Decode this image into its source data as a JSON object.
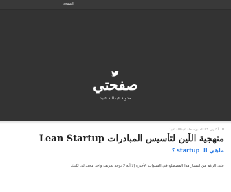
{
  "nav": {
    "link_label": "الصفحة"
  },
  "header": {
    "icon": "twitter-icon",
    "site_title": "صفحتي",
    "tagline": "مدونة عبدالله عبيد"
  },
  "post": {
    "meta": "10 أكتوبر، 2013 بواسطة عبدالله عبيد",
    "title": "منهجية اللّين لتأسيس المبادرات Lean Startup",
    "subtitle": "ماهي الـ startup ؟",
    "excerpt": "على الرغم من انتشار هذا المصطلح في السنوات الأخيرة إلا أنه لا يوجد تعريف واحد محدد له. لكنك"
  },
  "colors": {
    "hero_bg": "#333333",
    "accent": "#2a7ae2"
  }
}
